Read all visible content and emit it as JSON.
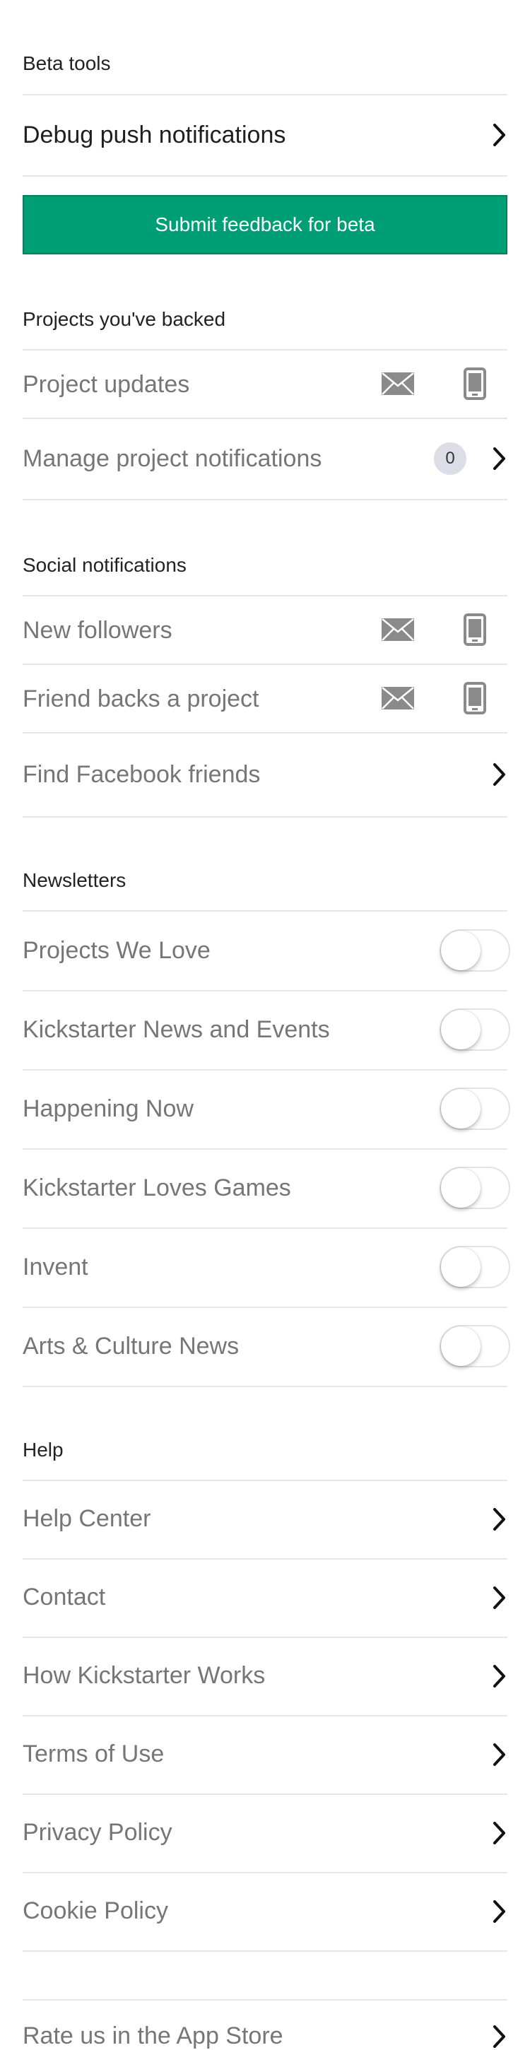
{
  "beta": {
    "title": "Beta tools",
    "debug_label": "Debug push notifications",
    "feedback_button": "Submit feedback for beta"
  },
  "backed": {
    "title": "Projects you've backed",
    "updates_label": "Project updates",
    "manage_label": "Manage project notifications",
    "manage_count": "0"
  },
  "social": {
    "title": "Social notifications",
    "followers_label": "New followers",
    "friend_backs_label": "Friend backs a project",
    "facebook_label": "Find Facebook friends"
  },
  "newsletters": {
    "title": "Newsletters",
    "items": [
      {
        "label": "Projects We Love",
        "enabled": false
      },
      {
        "label": "Kickstarter News and Events",
        "enabled": false
      },
      {
        "label": "Happening Now",
        "enabled": false
      },
      {
        "label": "Kickstarter Loves Games",
        "enabled": false
      },
      {
        "label": "Invent",
        "enabled": false
      },
      {
        "label": "Arts & Culture News",
        "enabled": false
      }
    ]
  },
  "help": {
    "title": "Help",
    "items": [
      {
        "label": "Help Center"
      },
      {
        "label": "Contact"
      },
      {
        "label": "How Kickstarter Works"
      },
      {
        "label": "Terms of Use"
      },
      {
        "label": "Privacy Policy"
      },
      {
        "label": "Cookie Policy"
      }
    ]
  },
  "rate": {
    "label": "Rate us in the App Store"
  },
  "colors": {
    "accent_green": "#009e74",
    "icon_gray": "#8a8a8a",
    "divider": "#e6e6e6"
  }
}
